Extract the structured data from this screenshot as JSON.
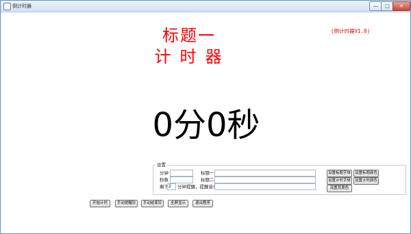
{
  "window": {
    "title": "倒计时器",
    "controls": {
      "minimize": "—",
      "maximize": "□",
      "close": "✕"
    }
  },
  "version_label": "(倒计时器V1.0)",
  "heading": {
    "title_line1": "标题一",
    "title_line2": "计时器"
  },
  "timer_display": "0分0秒",
  "settings": {
    "group_label": "设置",
    "minutes_label": "分钟",
    "minutes_value": "",
    "seconds_label": "秒数",
    "seconds_value": "",
    "remaining_label": "剩下",
    "remaining_value": "2",
    "reminder_label": "分钟提醒，提醒音乐为",
    "reminder_music_value": "",
    "title1_label": "标题一",
    "title1_value": "",
    "title2_label": "标题二",
    "title2_value": "",
    "buttons": {
      "set_title_font": "设置标题字体",
      "set_title_color": "设置标题颜色",
      "set_timer_font": "设置计时字体",
      "set_timer_color": "设置计时颜色",
      "set_background": "设置背景色"
    }
  },
  "bottom_buttons": {
    "start": "开始计时",
    "manual_remind": "手动提醒铃",
    "manual_end": "手动结束铃",
    "fullscreen": "全屏显示",
    "exit": "退出程序"
  },
  "colors": {
    "title": "#ff0000",
    "timer": "#000000"
  }
}
